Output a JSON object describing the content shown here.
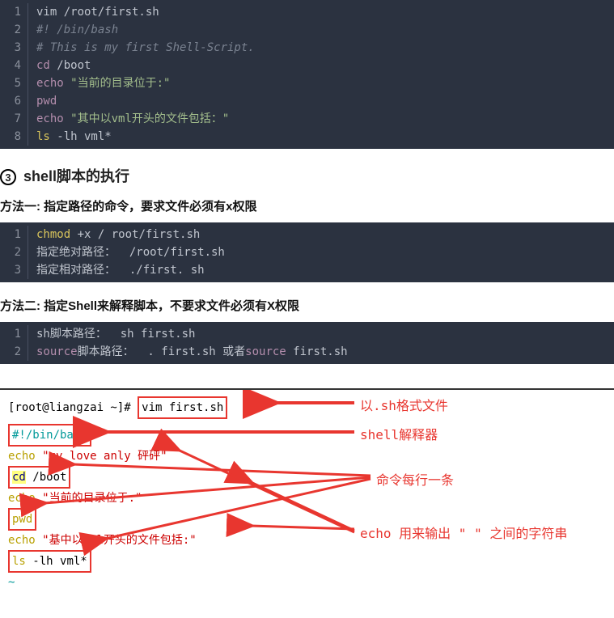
{
  "code1": {
    "lines": [
      {
        "n": "1",
        "seg": [
          {
            "t": "vim /root/first.sh",
            "c": "kw-arg"
          }
        ]
      },
      {
        "n": "2",
        "seg": [
          {
            "t": "#! /bin/bash",
            "c": "kw-comment"
          }
        ]
      },
      {
        "n": "3",
        "seg": [
          {
            "t": "# This is my first Shell-Script.",
            "c": "kw-comment"
          }
        ]
      },
      {
        "n": "4",
        "seg": [
          {
            "t": "cd",
            "c": "kw-keyword"
          },
          {
            "t": " /boot",
            "c": "kw-arg"
          }
        ]
      },
      {
        "n": "5",
        "seg": [
          {
            "t": "echo",
            "c": "kw-keyword"
          },
          {
            "t": " ",
            "c": ""
          },
          {
            "t": "\"当前的目录位于:\"",
            "c": "kw-string"
          }
        ]
      },
      {
        "n": "6",
        "seg": [
          {
            "t": "pwd",
            "c": "kw-keyword"
          }
        ]
      },
      {
        "n": "7",
        "seg": [
          {
            "t": "echo",
            "c": "kw-keyword"
          },
          {
            "t": " ",
            "c": ""
          },
          {
            "t": "\"其中以vml开头的文件包括：\"",
            "c": "kw-string"
          }
        ]
      },
      {
        "n": "8",
        "seg": [
          {
            "t": "ls",
            "c": "kw-cmd-y"
          },
          {
            "t": " -lh vml*",
            "c": "kw-arg"
          }
        ]
      }
    ]
  },
  "heading3_num": "3",
  "heading3": "shell脚本的执行",
  "method1": "方法一: 指定路径的命令，要求文件必须有x权限",
  "code2": {
    "lines": [
      {
        "n": "1",
        "seg": [
          {
            "t": "chmod",
            "c": "kw-cmd-y"
          },
          {
            "t": " +x / root/first.sh",
            "c": "kw-arg"
          }
        ]
      },
      {
        "n": "2",
        "seg": [
          {
            "t": "指定绝对路径：  /root/first.sh",
            "c": "kw-arg"
          }
        ]
      },
      {
        "n": "3",
        "seg": [
          {
            "t": "指定相对路径：  ./first. sh",
            "c": "kw-arg"
          }
        ]
      }
    ]
  },
  "method2": "方法二: 指定Shell来解释脚本，不要求文件必须有X权限",
  "code3": {
    "lines": [
      {
        "n": "1",
        "seg": [
          {
            "t": "sh脚本路径：  sh first.sh",
            "c": "kw-arg"
          }
        ]
      },
      {
        "n": "2",
        "seg": [
          {
            "t": "source",
            "c": "kw-keyword"
          },
          {
            "t": "脚本路径：  . first.sh 或者",
            "c": "kw-arg"
          },
          {
            "t": "source",
            "c": "kw-keyword"
          },
          {
            "t": " first.sh",
            "c": "kw-arg"
          }
        ]
      }
    ]
  },
  "term": {
    "prompt": "[root@liangzai ~]# ",
    "cmd": "vim first.sh",
    "l1": "#!/bin/bash",
    "l2a": "echo ",
    "l2b": "\"my love anly 砰砰\"",
    "l3a": "cd",
    "l3b": " /boot",
    "l4a": "echo ",
    "l4b": "\"当前的目录位于:\"",
    "l5": "pwd",
    "l6a": "echo ",
    "l6b": "\"基中以vml开头的文件包括:\"",
    "l7a": "ls ",
    "l7b": "-lh vml*",
    "tilde": "~"
  },
  "anno": {
    "a1": "以.sh格式文件",
    "a2": "shell解释器",
    "a3": "命令每行一条",
    "a4": "echo 用来输出 \" \" 之间的字符串"
  }
}
